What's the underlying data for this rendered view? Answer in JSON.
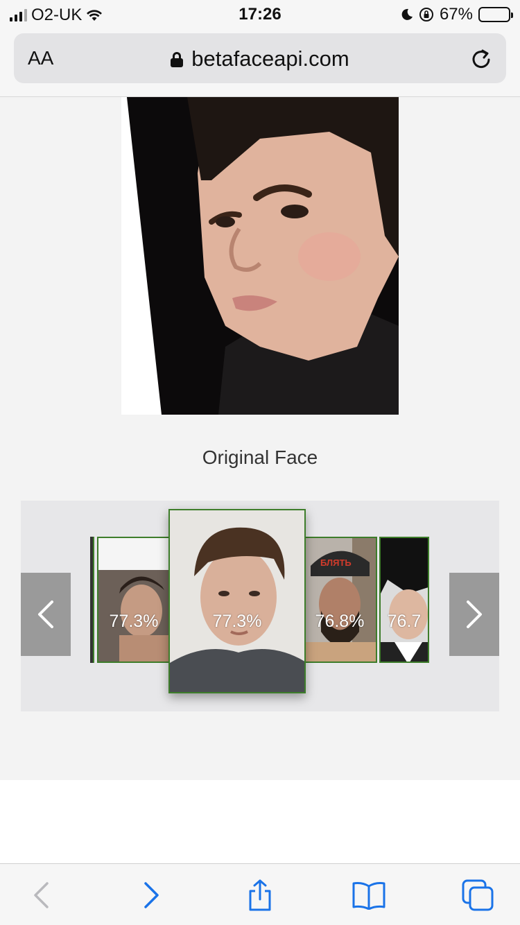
{
  "status_bar": {
    "carrier": "O2-UK",
    "time": "17:26",
    "battery_percent": "67%",
    "battery_level": 0.67
  },
  "url_bar": {
    "text_size_label": "AA",
    "domain": "betafaceapi.com"
  },
  "main": {
    "original_face_caption": "Original Face"
  },
  "carousel": {
    "matches": [
      {
        "score": "77.3%"
      },
      {
        "score": "77.3%"
      },
      {
        "score": "76.8%"
      },
      {
        "score": "76.7"
      }
    ]
  },
  "colors": {
    "match_border": "#3d7d2a",
    "nav_button": "#9a9a9a",
    "toolbar_icon": "#1a73e8"
  }
}
